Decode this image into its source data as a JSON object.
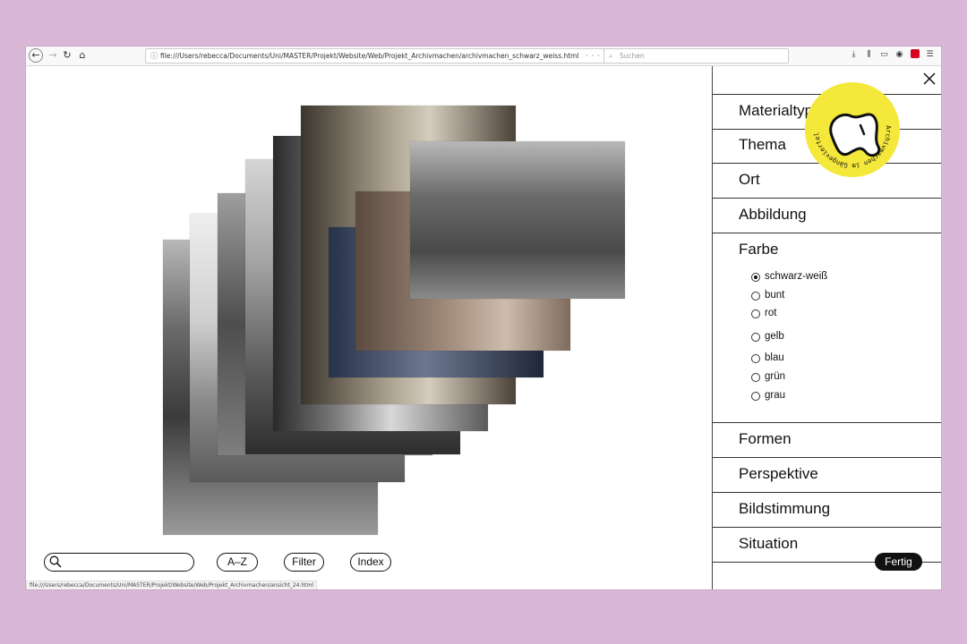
{
  "browser": {
    "url": "file:///Users/rebecca/Documents/Uni/MASTER/Projekt/Website/Web/Projekt_Archivmachen/archivmachen_schwarz_weiss.html",
    "search_placeholder": "Suchen",
    "status_url": "file:///Users/rebecca/Documents/Uni/MASTER/Projekt/Website/Web/Projekt_Archivmachen/ansicht_24.html"
  },
  "bottom": {
    "az_label": "A–Z",
    "filter_label": "Filter",
    "index_label": "Index"
  },
  "panel": {
    "categories": [
      "Materialtyp",
      "Thema",
      "Ort",
      "Abbildung",
      "Farbe",
      "Formen",
      "Perspektive",
      "Bildstimmung",
      "Situation"
    ],
    "farbe_options": [
      "schwarz-weiß",
      "bunt",
      "rot",
      "gelb",
      "blau",
      "grün",
      "grau"
    ],
    "selected_option": "schwarz-weiß",
    "done_label": "Fertig"
  },
  "badge": {
    "text": "Archivmachen im Gängeviertel",
    "color": "#f4e83b"
  },
  "colors": {
    "background": "#d9b7d6",
    "accent": "#111111"
  }
}
